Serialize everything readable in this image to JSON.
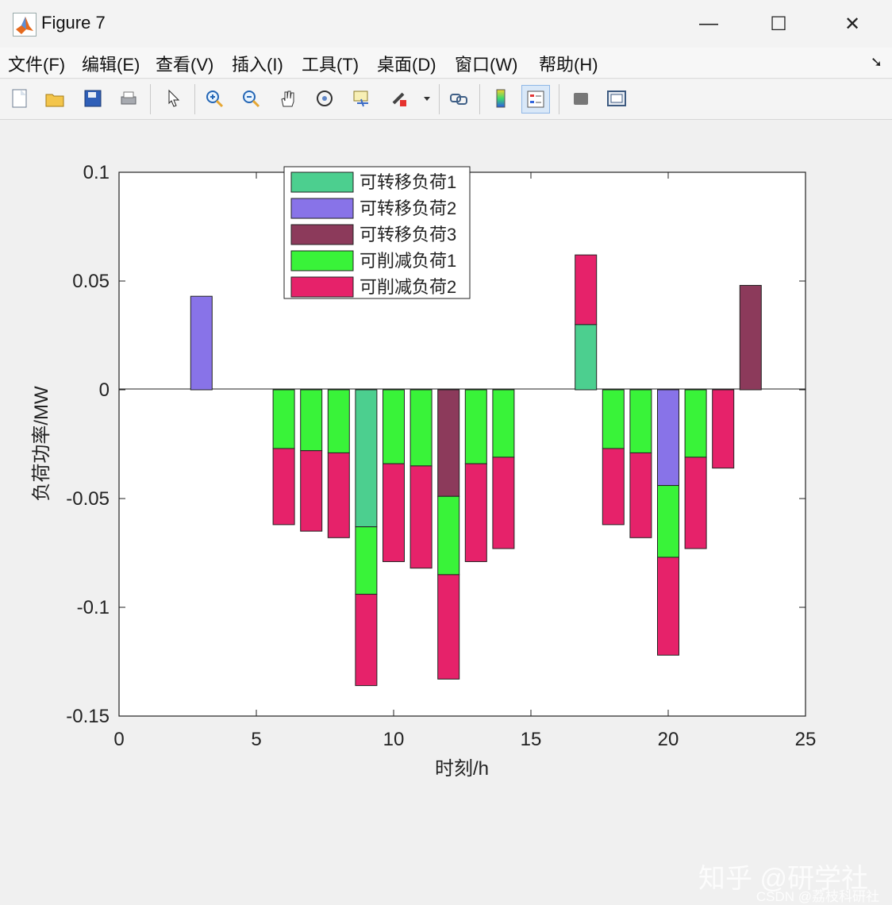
{
  "window": {
    "title": "Figure 7",
    "minimize": "—",
    "maximize": "☐",
    "close": "✕"
  },
  "menu": [
    "文件(F)",
    "编辑(E)",
    "查看(V)",
    "插入(I)",
    "工具(T)",
    "桌面(D)",
    "窗口(W)",
    "帮助(H)"
  ],
  "menu_arrow": "➘",
  "toolbar_icons": [
    "new-file-icon",
    "open-folder-icon",
    "save-icon",
    "print-icon",
    "select-arrow-icon",
    "zoom-in-icon",
    "zoom-out-icon",
    "pan-hand-icon",
    "rotate-3d-icon",
    "data-cursor-icon",
    "brush-icon",
    "brush-dropdown-icon",
    "link-icon",
    "colorbar-icon",
    "legend-icon",
    "hide-plot-tools-icon",
    "show-plot-tools-icon"
  ],
  "chart_data": {
    "type": "bar",
    "stacked": true,
    "xlabel": "时刻/h",
    "ylabel": "负荷功率/MW",
    "xlim": [
      0,
      25
    ],
    "ylim": [
      -0.15,
      0.1
    ],
    "xticks": [
      0,
      5,
      10,
      15,
      20,
      25
    ],
    "yticks": [
      0.1,
      0.05,
      0,
      -0.05,
      -0.1,
      -0.15
    ],
    "ytick_labels": [
      "0.1",
      "0.05",
      "0",
      "-0.05",
      "-0.1",
      "-0.15"
    ],
    "categories": [
      1,
      2,
      3,
      4,
      5,
      6,
      7,
      8,
      9,
      10,
      11,
      12,
      13,
      14,
      15,
      16,
      17,
      18,
      19,
      20,
      21,
      22,
      23,
      24
    ],
    "series": [
      {
        "name": "可转移负荷1",
        "color": "#4ccf8f",
        "values": [
          0,
          0,
          0,
          0,
          0,
          0,
          0,
          0,
          -0.063,
          0,
          0,
          0,
          0,
          0,
          0,
          0,
          0.03,
          0,
          0,
          0,
          0,
          0,
          0,
          0
        ]
      },
      {
        "name": "可转移负荷2",
        "color": "#8873e8",
        "values": [
          0,
          0,
          0.043,
          0,
          0,
          0,
          0,
          0,
          0,
          0,
          0,
          0,
          0,
          0,
          0,
          0,
          0,
          0,
          0,
          -0.044,
          0,
          0,
          0,
          0
        ]
      },
      {
        "name": "可转移负荷3",
        "color": "#8c3a5b",
        "values": [
          0,
          0,
          0,
          0,
          0,
          0,
          0,
          0,
          0,
          0,
          0,
          -0.049,
          0,
          0,
          0,
          0,
          0,
          0,
          0,
          0,
          0,
          0,
          0.048,
          0
        ]
      },
      {
        "name": "可削减负荷1",
        "color": "#39f339",
        "values": [
          0,
          0,
          0,
          0,
          0,
          -0.027,
          -0.028,
          -0.029,
          -0.031,
          -0.034,
          -0.035,
          -0.036,
          -0.034,
          -0.031,
          0,
          0,
          0,
          -0.027,
          -0.029,
          -0.033,
          -0.031,
          0,
          0,
          0
        ]
      },
      {
        "name": "可削减负荷2",
        "color": "#e6226a",
        "values": [
          0,
          0,
          0,
          0,
          0,
          -0.035,
          -0.037,
          -0.039,
          -0.042,
          -0.045,
          -0.047,
          -0.048,
          -0.045,
          -0.042,
          0,
          0,
          0.032,
          -0.035,
          -0.039,
          -0.045,
          -0.042,
          -0.036,
          0,
          0
        ]
      }
    ],
    "legend_position": "top-center",
    "grid": false
  },
  "watermark": {
    "line1": "知乎 @研学社",
    "line2": "CSDN @荔枝科研社"
  }
}
